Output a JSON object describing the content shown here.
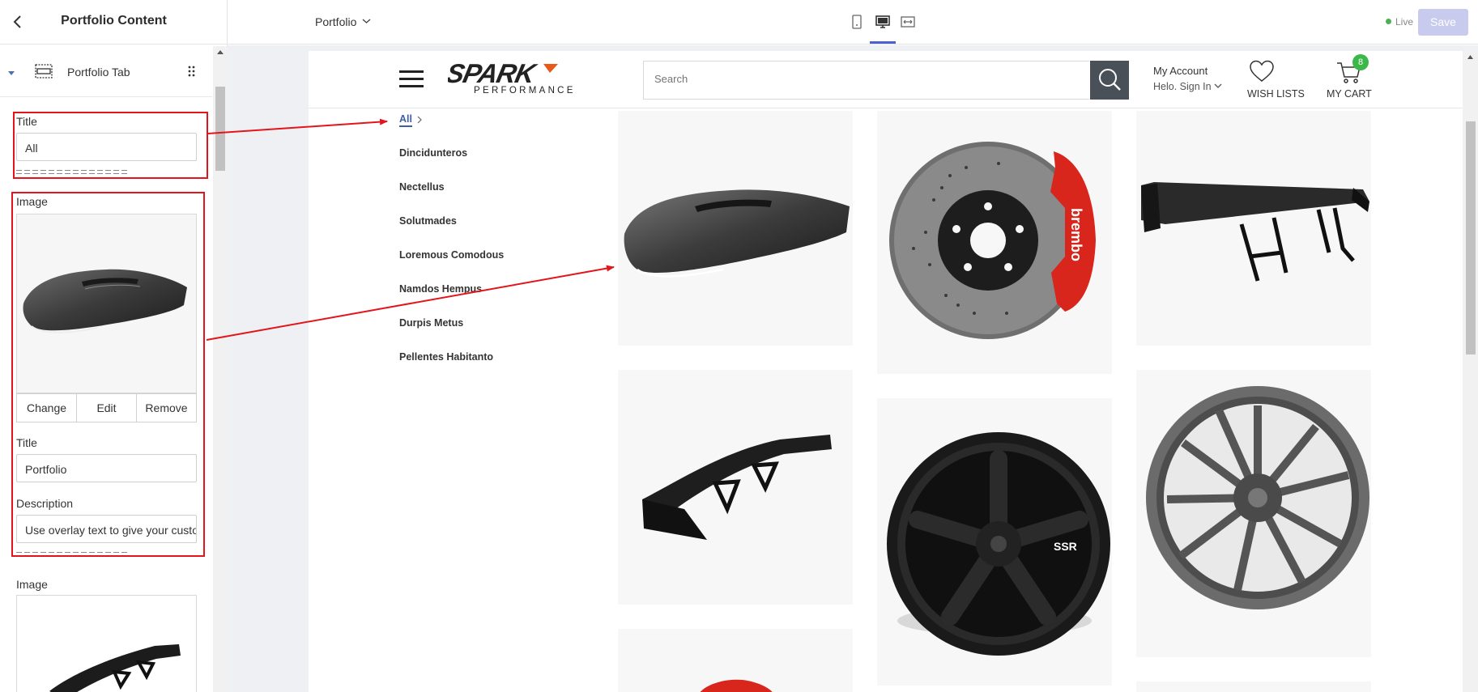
{
  "sidebar": {
    "title": "Portfolio Content",
    "section_label": "Portfolio Tab",
    "tab": {
      "title_label": "Title",
      "title_value": "All",
      "separator": "=============="
    },
    "item1": {
      "image_label": "Image",
      "image_alt": "Carbon fiber hood",
      "actions": [
        "Change",
        "Edit",
        "Remove"
      ],
      "title_label": "Title",
      "title_value": "Portfolio",
      "description_label": "Description",
      "description_value": "Use overlay text to give your customers insight",
      "separator": "=============="
    },
    "item2": {
      "image_label": "Image",
      "image_alt": "Rear wing spoiler"
    }
  },
  "topbar": {
    "page_selector": "Portfolio",
    "device_icons": [
      "mobile-icon",
      "desktop-icon",
      "fullwidth-icon"
    ],
    "active_device": "desktop",
    "status": "Live",
    "save_label": "Save"
  },
  "store": {
    "logo_text": "SPARK",
    "logo_sub": "PERFORMANCE",
    "search_placeholder": "Search",
    "account_label": "My Account",
    "signin_label": "Helo. Sign In",
    "wishlist_label": "WISH LISTS",
    "cart_label": "MY CART",
    "cart_count": "8",
    "categories_active": "All",
    "categories": [
      "Dincidunteros",
      "Nectellus",
      "Solutmades",
      "Loremous Comodous",
      "Namdos Hempus",
      "Durpis Metus",
      "Pellentes Habitanto"
    ],
    "products": [
      {
        "name": "carbon-hood"
      },
      {
        "name": "brembo-brake-disc"
      },
      {
        "name": "rear-wing-black"
      },
      {
        "name": "rear-wing-carbon"
      },
      {
        "name": "ssr-black-wheel"
      },
      {
        "name": "grey-spoke-wheel"
      },
      {
        "name": "red-part"
      }
    ]
  },
  "colors": {
    "highlight": "#e3151b",
    "accent": "#4c5fd5",
    "live": "#4caf50",
    "cart_badge": "#3cb84a",
    "link": "#3d5fa8",
    "brake_caliper": "#d9261c"
  }
}
